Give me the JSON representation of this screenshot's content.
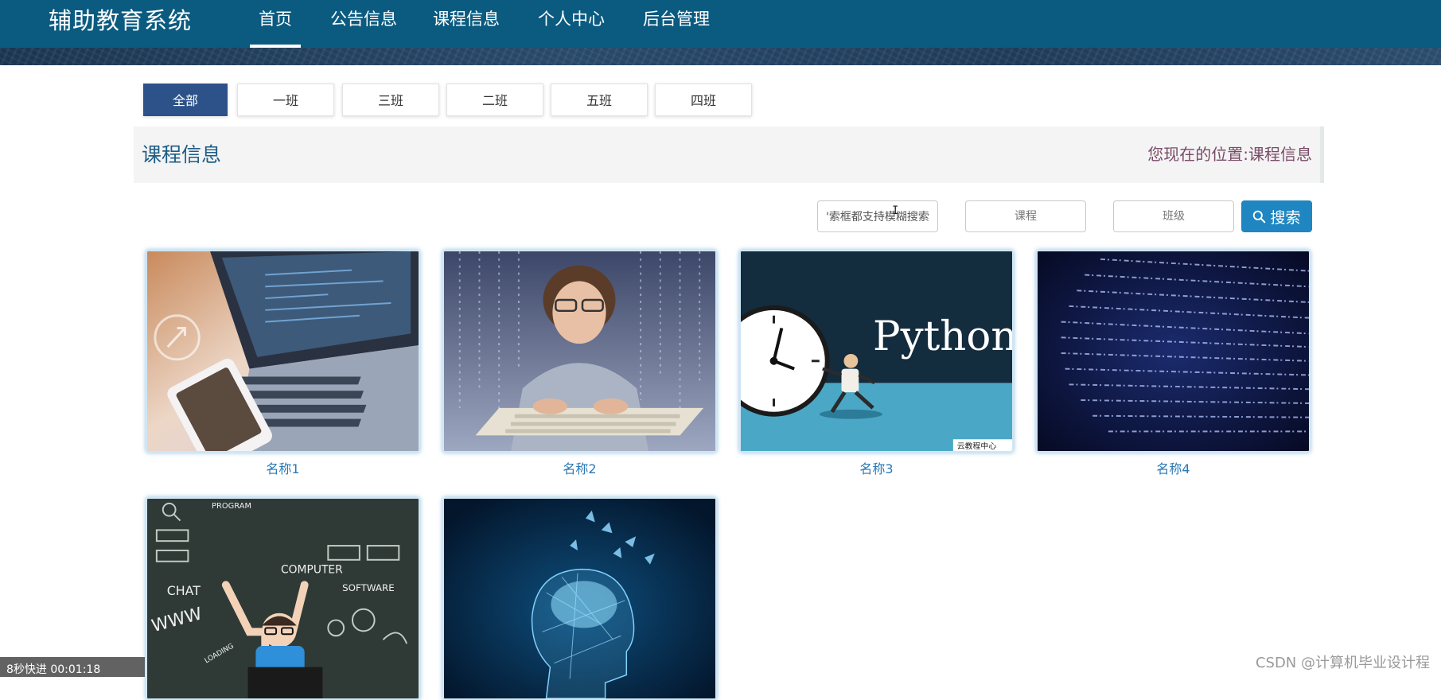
{
  "navbar": {
    "brand": "辅助教育系统",
    "items": [
      {
        "label": "首页",
        "active": true
      },
      {
        "label": "公告信息",
        "active": false
      },
      {
        "label": "课程信息",
        "active": false
      },
      {
        "label": "个人中心",
        "active": false
      },
      {
        "label": "后台管理",
        "active": false
      }
    ]
  },
  "categories": [
    "全部",
    "一班",
    "三班",
    "二班",
    "五班",
    "四班"
  ],
  "active_category": "全部",
  "section": {
    "title": "课程信息",
    "location_label": "您现在的位置:",
    "location_value": "课程信息"
  },
  "search": {
    "keyword_value": "'索框都支持模糊搜索",
    "course_placeholder": "课程",
    "class_placeholder": "班级",
    "button_label": "搜索"
  },
  "cards": [
    {
      "label": "名称1",
      "icon": "laptop-photo"
    },
    {
      "label": "名称2",
      "icon": "boy-keyboard-photo"
    },
    {
      "label": "名称3",
      "icon": "python-clock-photo",
      "image_text": "Python",
      "image_badge": "云教程中心"
    },
    {
      "label": "名称4",
      "icon": "code-stream-photo"
    },
    {
      "label": "",
      "icon": "kid-chalkboard-photo",
      "image_words": [
        "PROGRAM",
        "CHAT",
        "WWW",
        "COMPUTER",
        "SOFTWARE",
        "LOADING"
      ]
    },
    {
      "label": "",
      "icon": "ai-head-photo"
    }
  ],
  "overlay": {
    "player_text": "8秒快进  00:01:18",
    "watermark": "CSDN @计算机毕业设计程"
  },
  "colors": {
    "nav": "#0b5b80",
    "active_tab": "#2c5289",
    "search_button": "#1f86c2",
    "title": "#1d5d86",
    "card_label": "#2a78b5"
  }
}
